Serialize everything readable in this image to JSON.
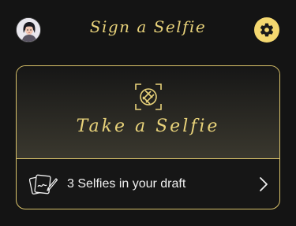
{
  "header": {
    "title": "Sign a Selfie",
    "avatar": "user-avatar",
    "settings_icon": "gear-icon"
  },
  "selfie_card": {
    "label": "Take a Selfie",
    "icon": "camera-shutter-icon"
  },
  "draft_row": {
    "text": "3 Selfies in your draft",
    "icon": "signed-photos-icon",
    "chevron_icon": "chevron-right-icon"
  },
  "colors": {
    "accent": "#e8d27a",
    "settings_button": "#f4d870",
    "background": "#141414",
    "card_border": "#d9c26a"
  }
}
